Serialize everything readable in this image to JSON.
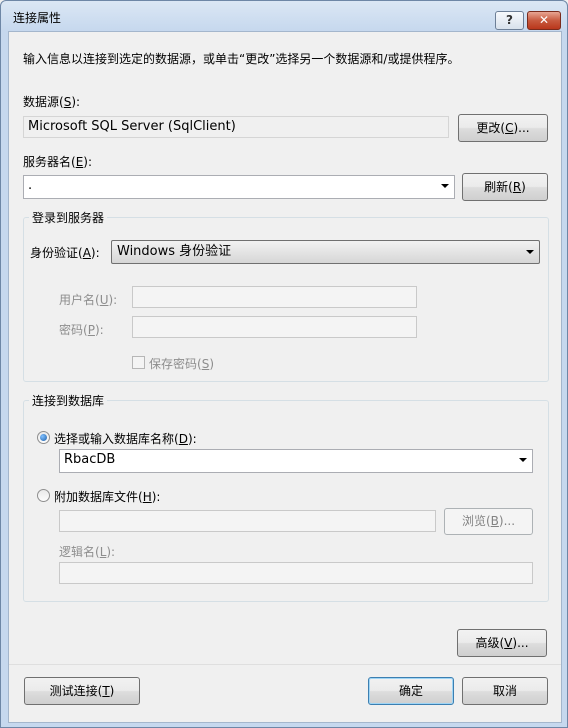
{
  "window": {
    "title": "连接属性",
    "help_label": "?",
    "close_label": "✕"
  },
  "description": "输入信息以连接到选定的数据源，或单击“更改”选择另一个数据源和/或提供程序。",
  "datasource": {
    "label": "数据源(",
    "label_key": "S",
    "label_end": "):",
    "value": "Microsoft SQL Server (SqlClient)",
    "change_label": "更改(",
    "change_key": "C",
    "change_end": ")..."
  },
  "server": {
    "label": "服务器名(",
    "label_key": "E",
    "label_end": "):",
    "value": ".",
    "refresh_label": "刷新(",
    "refresh_key": "R",
    "refresh_end": ")"
  },
  "login_group": {
    "title": "登录到服务器",
    "auth_label": "身份验证(",
    "auth_key": "A",
    "auth_end": "):",
    "auth_value": "Windows 身份验证",
    "username_label": "用户名(",
    "username_key": "U",
    "username_end": "):",
    "password_label": "密码(",
    "password_key": "P",
    "password_end": "):",
    "save_password_label": "保存密码(",
    "save_password_key": "S",
    "save_password_end": ")"
  },
  "db_group": {
    "title": "连接到数据库",
    "select_db_label": "选择或输入数据库名称(",
    "select_db_key": "D",
    "select_db_end": "):",
    "select_db_value": "RbacDB",
    "attach_label": "附加数据库文件(",
    "attach_key": "H",
    "attach_end": "):",
    "browse_label": "浏览(",
    "browse_key": "B",
    "browse_end": ")...",
    "logical_label": "逻辑名(",
    "logical_key": "L",
    "logical_end": "):"
  },
  "buttons": {
    "advanced": "高级(",
    "advanced_key": "V",
    "advanced_end": ")...",
    "test": "测试连接(",
    "test_key": "T",
    "test_end": ")",
    "ok": "确定",
    "cancel": "取消"
  }
}
